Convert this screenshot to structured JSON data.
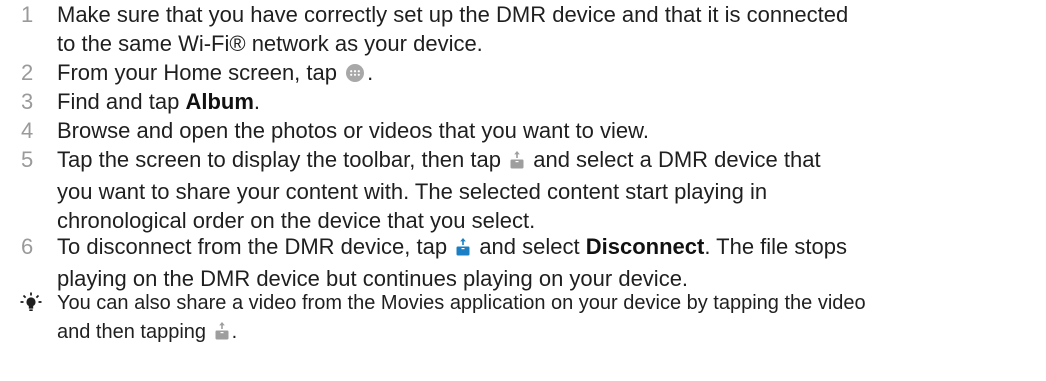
{
  "steps": [
    {
      "number": "1",
      "line1": "Make sure that you have correctly set up the DMR device and that it is connected",
      "line2": "to the same Wi-Fi® network as your device."
    },
    {
      "number": "2",
      "before": "From your Home screen, tap",
      "icon": "app-grid-icon",
      "after": "."
    },
    {
      "number": "3",
      "before": "Find and tap ",
      "bold": "Album",
      "after": "."
    },
    {
      "number": "4",
      "text": "Browse and open the photos or videos that you want to view."
    },
    {
      "number": "5",
      "before": "Tap the screen to display the toolbar, then tap",
      "icon": "share-device-icon",
      "after": "and select a DMR device that",
      "line2": "you want to share your content with. The selected content start playing in",
      "line3": "chronological order on the device that you select."
    },
    {
      "number": "6",
      "before": "To disconnect from the DMR device, tap",
      "icon": "share-device-active-icon",
      "mid": "and select ",
      "bold": "Disconnect",
      "after": ". The file stops",
      "line2": "playing on the DMR device but continues playing on your device."
    }
  ],
  "tip": {
    "icon": "lightbulb-tip-icon",
    "line1": "You can also share a video from the Movies application on your device by tapping the video",
    "line2_before": "and then tapping",
    "line2_icon": "share-device-icon",
    "line2_after": "."
  },
  "colors": {
    "text": "#1f1f1f",
    "step_number": "#9a9a9a",
    "icon_gray": "#9e9e9e",
    "icon_blue": "#1a7fc4"
  }
}
